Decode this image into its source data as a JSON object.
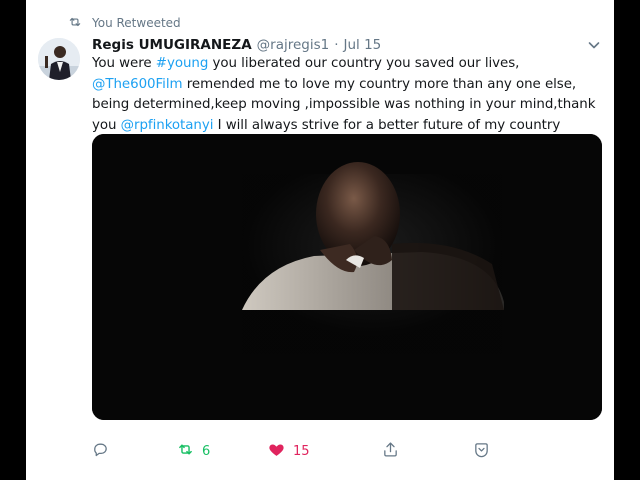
{
  "retweet_banner": {
    "label": "You Retweeted",
    "icon": "retweet-icon"
  },
  "tweet": {
    "author_name": "Regis UMUGIRANEZA",
    "author_handle": "@rajregis1",
    "separator": "·",
    "date": "Jul 15",
    "text_lines": [
      {
        "before": "You were ",
        "link": "#young",
        "after": " you liberated our country you saved our lives,"
      },
      {
        "before": "",
        "link": "@The600Film",
        "after": " remended me to love my country more than any one else,"
      },
      {
        "before": "being determined,keep moving ,impossible was nothing in your mind,thank",
        "link": "",
        "after": ""
      },
      {
        "before": "you ",
        "link": "@rpfinkotanyi",
        "after": " I will always strive for a better future of my country"
      }
    ]
  },
  "actions": {
    "reply": {
      "icon": "reply-icon"
    },
    "retweet": {
      "icon": "retweet-icon",
      "count": "6",
      "color": "#17bf63"
    },
    "like": {
      "icon": "heart-icon",
      "count": "15",
      "color": "#e0245e"
    },
    "share": {
      "icon": "share-icon"
    },
    "more": {
      "icon": "chevron-box-icon"
    }
  },
  "colors": {
    "link": "#1da1f2",
    "secondary_text": "#657786",
    "primary_text": "#14171a"
  }
}
